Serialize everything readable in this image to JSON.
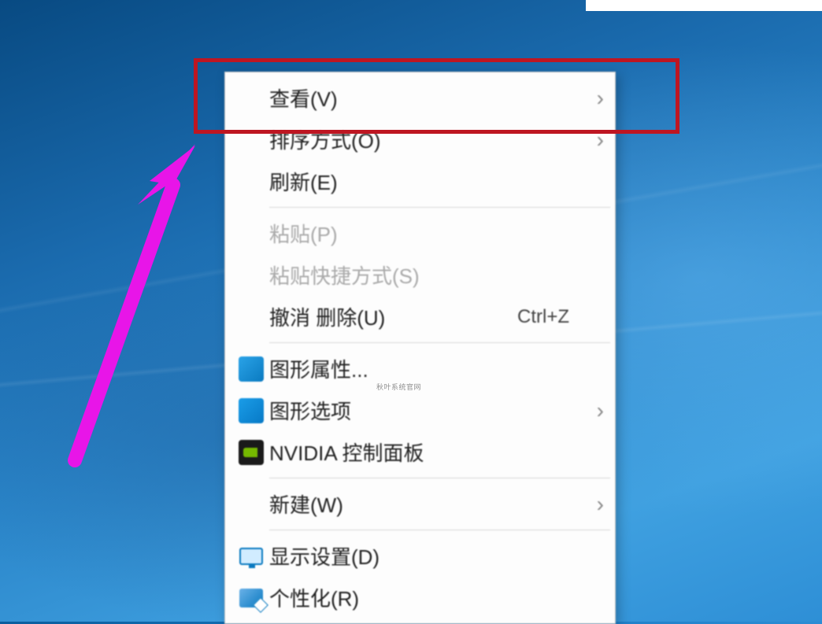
{
  "menu": {
    "items": [
      {
        "label": "查看(V)",
        "has_submenu": true,
        "disabled": false,
        "icon": null,
        "shortcut": ""
      },
      {
        "label": "排序方式(O)",
        "has_submenu": true,
        "disabled": false,
        "icon": null,
        "shortcut": ""
      },
      {
        "label": "刷新(E)",
        "has_submenu": false,
        "disabled": false,
        "icon": null,
        "shortcut": ""
      },
      {
        "separator": true
      },
      {
        "label": "粘贴(P)",
        "has_submenu": false,
        "disabled": true,
        "icon": null,
        "shortcut": ""
      },
      {
        "label": "粘贴快捷方式(S)",
        "has_submenu": false,
        "disabled": true,
        "icon": null,
        "shortcut": ""
      },
      {
        "label": "撤消 删除(U)",
        "has_submenu": false,
        "disabled": false,
        "icon": null,
        "shortcut": "Ctrl+Z"
      },
      {
        "separator": true
      },
      {
        "label": "图形属性...",
        "has_submenu": false,
        "disabled": false,
        "icon": "intel1",
        "shortcut": ""
      },
      {
        "label": "图形选项",
        "has_submenu": true,
        "disabled": false,
        "icon": "intel2",
        "shortcut": ""
      },
      {
        "label": "NVIDIA 控制面板",
        "has_submenu": false,
        "disabled": false,
        "icon": "nvidia",
        "shortcut": ""
      },
      {
        "separator": true
      },
      {
        "label": "新建(W)",
        "has_submenu": true,
        "disabled": false,
        "icon": null,
        "shortcut": ""
      },
      {
        "separator": true
      },
      {
        "label": "显示设置(D)",
        "has_submenu": false,
        "disabled": false,
        "icon": "display",
        "shortcut": ""
      },
      {
        "label": "个性化(R)",
        "has_submenu": false,
        "disabled": false,
        "icon": "personalize",
        "shortcut": ""
      }
    ]
  },
  "annotation": {
    "highlight_color": "#be1622",
    "arrow_color": "#e815e8"
  }
}
